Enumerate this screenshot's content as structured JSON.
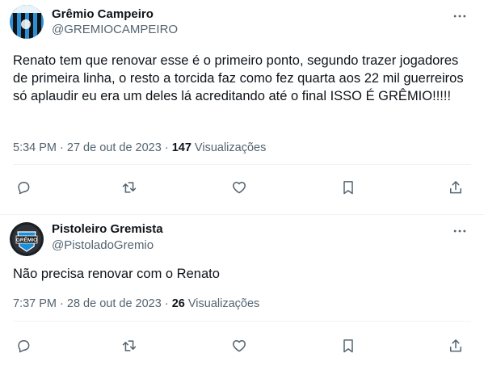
{
  "tweets": [
    {
      "author_name": "Grêmio Campeiro",
      "author_handle": "@GREMIOCAMPEIRO",
      "text": "Renato tem que renovar esse é o primeiro ponto, segundo trazer jogadores de primeira linha, o resto a torcida faz como fez quarta aos 22 mil guerreiros só aplaudir eu era um deles lá acreditando até o final ISSO É GRÊMIO!!!!!",
      "time": "5:34 PM",
      "date": "27 de out de 2023",
      "separator": " · ",
      "views_count": "147",
      "views_label": " Visualizações"
    },
    {
      "author_name": "Pistoleiro Gremista",
      "author_handle": "@PistoladoGremio",
      "text": "Não precisa renovar com o Renato",
      "time": "7:37 PM",
      "date": "28 de out de 2023",
      "separator": " · ",
      "views_count": "26",
      "views_label": " Visualizações"
    }
  ],
  "avatar_badge_text": "GRÊMIO",
  "icons": {
    "more": "more-icon",
    "reply": "reply-icon",
    "retweet": "retweet-icon",
    "like": "like-icon",
    "bookmark": "bookmark-icon",
    "share": "share-icon"
  },
  "colors": {
    "text": "#0f1419",
    "secondary": "#536471",
    "divider": "#eff3f4",
    "gremio_blue": "#1e8fd6",
    "gremio_black": "#111111"
  }
}
